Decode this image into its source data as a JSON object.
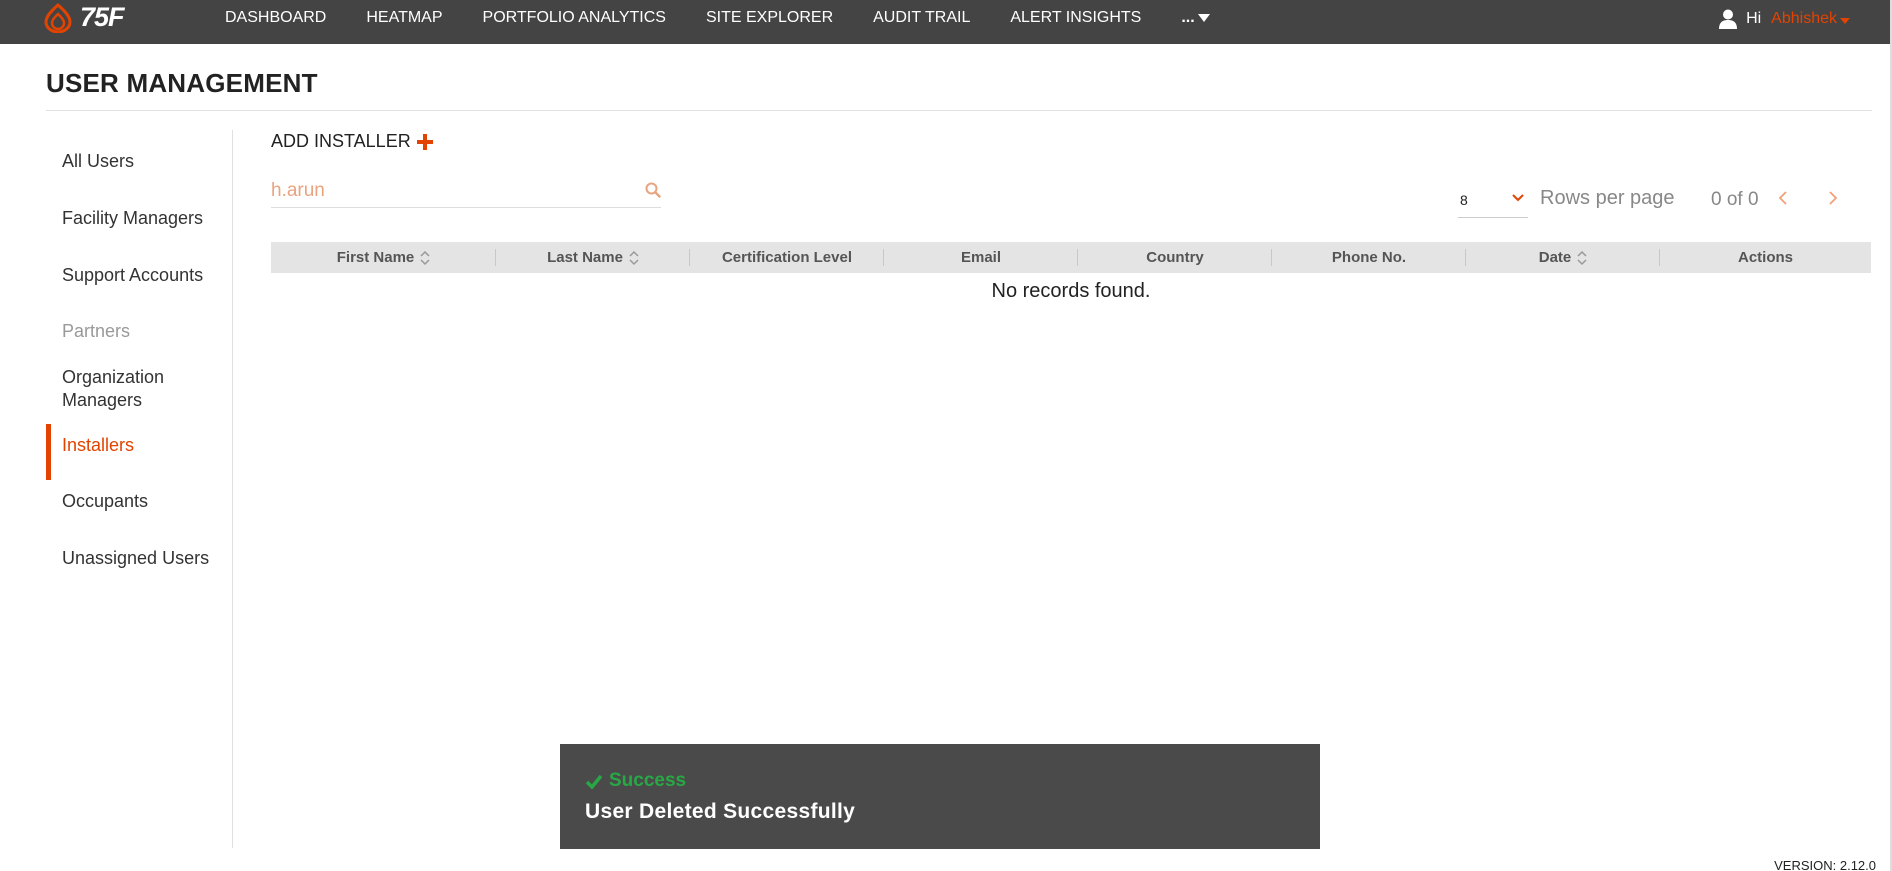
{
  "topnav": {
    "logo_text": "75F",
    "items": [
      "DASHBOARD",
      "HEATMAP",
      "PORTFOLIO ANALYTICS",
      "SITE EXPLORER",
      "AUDIT TRAIL",
      "ALERT INSIGHTS"
    ],
    "more_label": "...",
    "greeting": "Hi",
    "user_name": "Abhishek"
  },
  "page": {
    "title": "USER MANAGEMENT"
  },
  "sidebar": {
    "items": [
      {
        "label": "All Users"
      },
      {
        "label": "Facility Managers"
      },
      {
        "label": "Support Accounts"
      },
      {
        "label": "Partners"
      },
      {
        "label": "Organization Managers"
      },
      {
        "label": "Installers"
      },
      {
        "label": "Occupants"
      },
      {
        "label": "Unassigned Users"
      }
    ]
  },
  "main": {
    "add_label": "ADD INSTALLER",
    "search": {
      "value": "h.arun"
    },
    "pagination": {
      "rows_per_page_value": "8",
      "rows_per_page_label": "Rows per page",
      "count": "0 of 0"
    },
    "table": {
      "columns": [
        "First Name",
        "Last Name",
        "Certification Level",
        "Email",
        "Country",
        "Phone No.",
        "Date",
        "Actions"
      ],
      "empty_text": "No records found."
    }
  },
  "toast": {
    "title": "Success",
    "message": "User Deleted Successfully"
  },
  "footer": {
    "version": "VERSION: 2.12.0"
  },
  "colors": {
    "accent": "#e24301",
    "nav_bg": "#444444",
    "success": "#28a745",
    "toast_bg": "#4a4a4a"
  }
}
